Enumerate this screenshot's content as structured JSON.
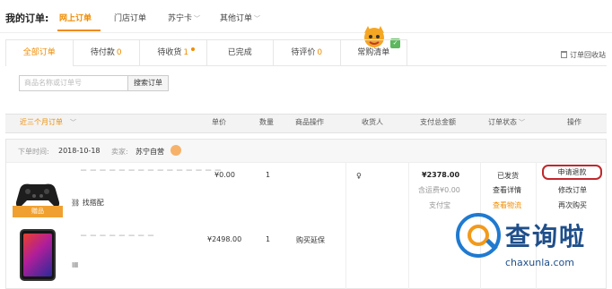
{
  "header": {
    "my_orders": "我的订单:",
    "nav": [
      "网上订单",
      "门店订单",
      "苏宁卡",
      "其他订单"
    ]
  },
  "tabs": [
    {
      "label": "全部订单",
      "count": ""
    },
    {
      "label": "待付款",
      "count": "0"
    },
    {
      "label": "待收货",
      "count": "1"
    },
    {
      "label": "已完成",
      "count": ""
    },
    {
      "label": "待评价",
      "count": "0"
    },
    {
      "label": "常购清单",
      "count": ""
    }
  ],
  "recycle_bin": "订单回收站",
  "search": {
    "placeholder": "商品名称或订单号",
    "button": "搜索订单"
  },
  "table_header": {
    "period": "近三个月订单",
    "price": "单价",
    "quantity": "数量",
    "product_ops": "商品操作",
    "receiver": "收货人",
    "total": "支付总金额",
    "status": "订单状态",
    "ops": "操作"
  },
  "order": {
    "date_label": "下单时间:",
    "date": "2018-10-18",
    "seller_label": "卖家:",
    "seller": "苏宁自营",
    "items": [
      {
        "price": "¥0.00",
        "qty": "1",
        "product_op": "",
        "gift_tag": "赠品",
        "match_label": "找搭配"
      },
      {
        "price": "¥2498.00",
        "qty": "1",
        "product_op": "购买延保"
      }
    ],
    "total": "¥2378.00",
    "freight": "含运费¥0.00",
    "pay_method": "支付宝",
    "status": "已发货",
    "view_detail": "查看详情",
    "view_logistics": "查看物流",
    "actions": {
      "refund": "申请退款",
      "modify": "修改订单",
      "rebuy": "再次购买"
    }
  },
  "watermark": {
    "title": "查询啦",
    "url": "chaxunla.com"
  },
  "colors": {
    "accent": "#f08c00",
    "highlight_circle": "#c0282d",
    "watermark_blue": "#1f4f8a"
  }
}
